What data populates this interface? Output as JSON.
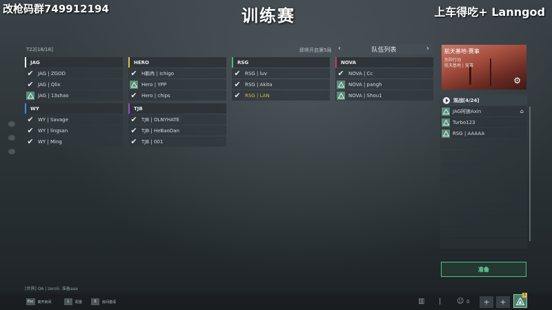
{
  "watermark_left": "改枪码群749912194",
  "watermark_right": "上车得吃+ Lanngod",
  "title": "训练赛",
  "round_label": "T22[18/18]",
  "next_round": "即将开启第5局",
  "team_list_header": "队伍列表",
  "teams": [
    {
      "name": "JAG",
      "color": "#ffffff",
      "members": [
        {
          "name": "JAG | ZGOD",
          "status": "ready"
        },
        {
          "name": "JAG | Qlix",
          "status": "ready"
        },
        {
          "name": "JAG | 13shao",
          "status": "waiting"
        }
      ]
    },
    {
      "name": "HERO",
      "color": "#e5c242",
      "members": [
        {
          "name": "H鹏冉 | Ichigo",
          "status": "ready"
        },
        {
          "name": "Hero | YPP",
          "status": "waiting"
        },
        {
          "name": "Hero | chips",
          "status": "ready"
        }
      ]
    },
    {
      "name": "RSG",
      "color": "#3fc27a",
      "members": [
        {
          "name": "RSG | luv",
          "status": "ready"
        },
        {
          "name": "RSG | Akita",
          "status": "ready"
        },
        {
          "name": "RSG | LAN",
          "status": "ready",
          "highlight": true
        }
      ]
    },
    {
      "name": "NOVA",
      "color": "#d8335a",
      "members": [
        {
          "name": "NOVA | Cc",
          "status": "ready"
        },
        {
          "name": "NOVA | pangh",
          "status": "waiting"
        },
        {
          "name": "NOVA | Shou1",
          "status": "waiting"
        }
      ]
    },
    {
      "name": "WY",
      "color": "#3a8fe0",
      "members": [
        {
          "name": "WY | Savage",
          "status": "ready"
        },
        {
          "name": "WY | lingsan",
          "status": "ready"
        },
        {
          "name": "WY | Ming",
          "status": "ready"
        }
      ]
    },
    {
      "name": "TJB",
      "color": "#9a4ed8",
      "members": [
        {
          "name": "TJB | OLNYHATE",
          "status": "ready"
        },
        {
          "name": "TJB | HeBaoDan",
          "status": "ready"
        },
        {
          "name": "TJB | 001",
          "status": "ready"
        }
      ]
    }
  ],
  "event": {
    "title": "航天基地-赛事",
    "line1": "危险行动",
    "line2": "航天基地 | 竞赛"
  },
  "spectate": {
    "header": "观战[4/24]",
    "rows": [
      {
        "name": "JAG阿狼Axin",
        "home": true
      },
      {
        "name": "Turbo123",
        "home": false
      },
      {
        "name": "RSG | AAAAA",
        "home": false
      }
    ]
  },
  "ready_label": "准备",
  "chat_line": "[世界] OA | zero5: 准备aaa",
  "hints": [
    {
      "key": "Esc",
      "label": "离开房间"
    },
    {
      "key": "L",
      "label": "配置"
    },
    {
      "key": "S",
      "label": "房间邀请"
    }
  ],
  "player_count": "0",
  "notification_count": "1"
}
